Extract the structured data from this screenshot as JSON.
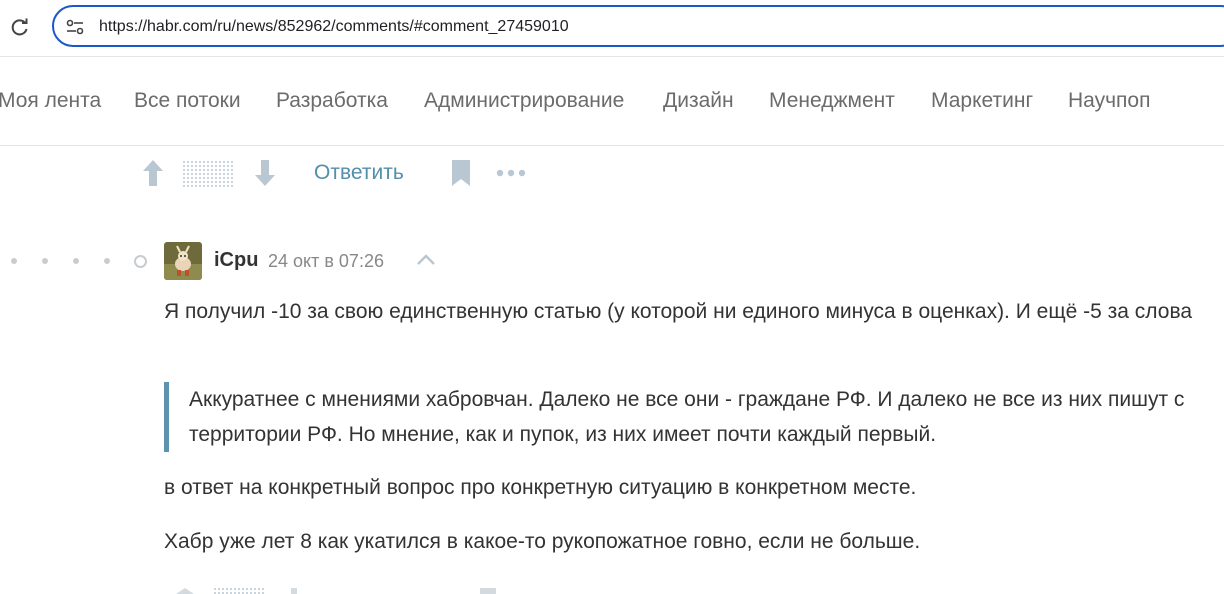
{
  "browser": {
    "url": "https://habr.com/ru/news/852962/comments/#comment_27459010"
  },
  "nav": {
    "items": [
      "Моя лента",
      "Все потоки",
      "Разработка",
      "Администрирование",
      "Дизайн",
      "Менеджмент",
      "Маркетинг",
      "Научпоп"
    ]
  },
  "actions": {
    "reply_label": "Ответить"
  },
  "comment": {
    "author": "iCpu",
    "time": "24 окт в 07:26",
    "p1": "Я получил -10 за свою единственную статью (у которой ни единого минуса в оценках). И ещё -5 за слова",
    "quote": "Аккуратнее с мнениями хабровчан. Далеко не все они - граждане РФ. И далеко не все из них пишут с территории РФ. Но мнение, как и пупок, из них имеет почти каждый первый.",
    "p2": "в ответ на конкретный вопрос про конкретную ситуацию в конкретном месте.",
    "p3": "Хабр уже лет 8 как укатился в какое-то рукопожатное говно, если не больше."
  },
  "colors": {
    "accent": "#548eaa",
    "quote_border": "#5e93ad",
    "url_border": "#1a57c8"
  }
}
